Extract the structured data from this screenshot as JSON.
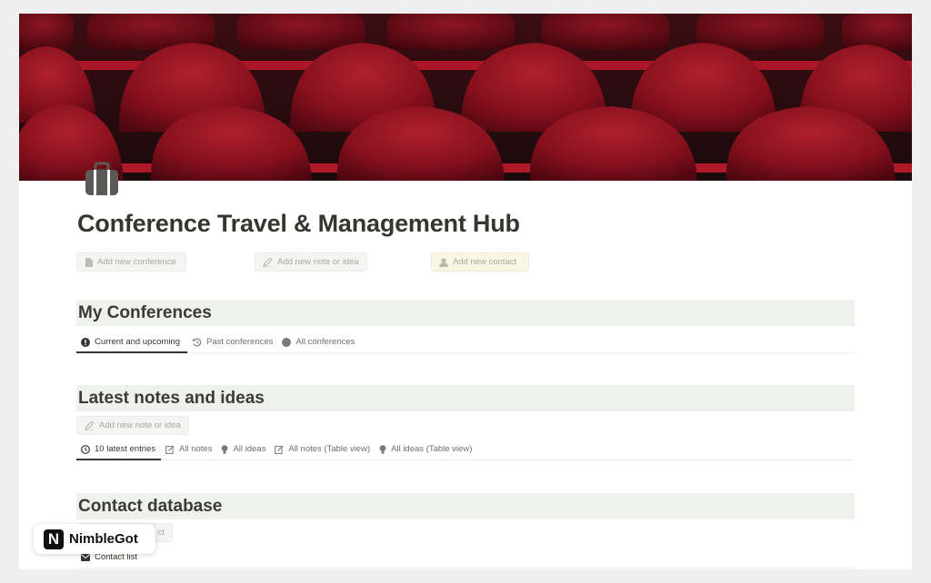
{
  "page": {
    "title": "Conference Travel & Management Hub",
    "icon": "suitcase-icon"
  },
  "quick_actions": [
    {
      "label": "Add new conference",
      "icon": "document-icon"
    },
    {
      "label": "Add new note or idea",
      "icon": "pen-icon"
    },
    {
      "label": "Add new contact",
      "icon": "person-icon"
    }
  ],
  "sections": {
    "conferences": {
      "title": "My Conferences",
      "tabs": [
        {
          "label": "Current and upcoming",
          "icon": "exclamation-circle-icon"
        },
        {
          "label": "Past conferences",
          "icon": "history-icon"
        },
        {
          "label": "All conferences",
          "icon": "filled-circle-icon"
        }
      ]
    },
    "notes": {
      "title": "Latest notes and ideas",
      "add_button": "Add new note or idea",
      "tabs": [
        {
          "label": "10 latest entries",
          "icon": "clock-icon"
        },
        {
          "label": "All notes",
          "icon": "edit-icon"
        },
        {
          "label": "All ideas",
          "icon": "lightbulb-icon"
        },
        {
          "label": "All notes (Table view)",
          "icon": "edit-icon"
        },
        {
          "label": "All ideas (Table view)",
          "icon": "lightbulb-icon"
        }
      ]
    },
    "contacts": {
      "title": "Contact database",
      "add_button_partial": "ct",
      "tabs": [
        {
          "label": "Contact list",
          "icon": "mail-icon"
        }
      ]
    }
  },
  "watermark": {
    "logo_letter": "N",
    "name": "NimbleGot"
  },
  "colors": {
    "section_header_bg": "#eef1ec",
    "cover_red": "#8c0f1c",
    "contact_button_bg": "#fbf6e3"
  }
}
